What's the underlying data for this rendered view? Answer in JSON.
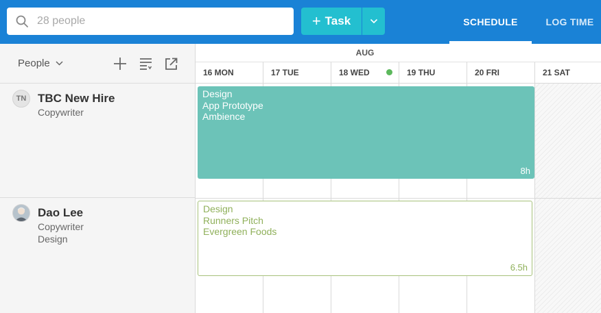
{
  "header": {
    "search": {
      "placeholder": "28 people",
      "value": ""
    },
    "task_button": {
      "plus": "+",
      "label": "Task"
    },
    "tabs": [
      {
        "label": "SCHEDULE",
        "active": true
      },
      {
        "label": "LOG TIME",
        "active": false
      }
    ]
  },
  "left_panel": {
    "people_filter": "People",
    "people": [
      {
        "initials": "TN",
        "name": "TBC New Hire",
        "role": "Copywriter",
        "department": ""
      },
      {
        "initials": "",
        "name": "Dao Lee",
        "role": "Copywriter",
        "department": "Design"
      }
    ]
  },
  "calendar": {
    "month": "AUG",
    "days": [
      {
        "label": "16 MON"
      },
      {
        "label": "17 TUE"
      },
      {
        "label": "18 WED",
        "today": true
      },
      {
        "label": "19 THU"
      },
      {
        "label": "20 FRI"
      },
      {
        "label": "21 SAT",
        "weekend": true
      }
    ],
    "tasks": [
      {
        "line1": "Design",
        "line2": "App Prototype",
        "line3": "Ambience",
        "hours": "8h",
        "style": "teal"
      },
      {
        "line1": "Design",
        "line2": "Runners Pitch",
        "line3": "Evergreen Foods",
        "hours": "6.5h",
        "style": "outline"
      }
    ]
  },
  "colors": {
    "header_bg": "#1a82d6",
    "accent": "#23bfd0",
    "task_teal": "#6cc3b8",
    "task_outline": "#a6c17a",
    "today_dot": "#5cb85c"
  }
}
